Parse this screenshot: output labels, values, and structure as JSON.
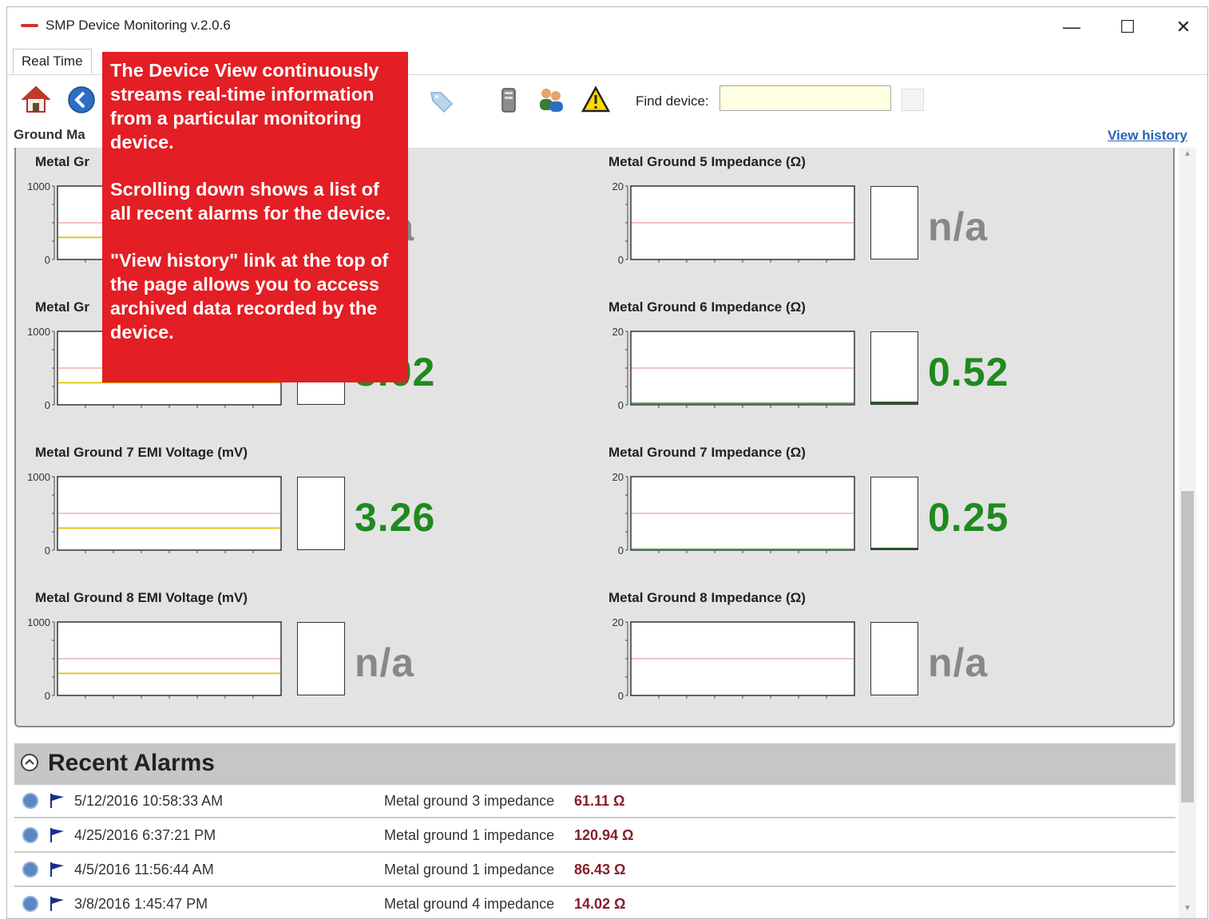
{
  "window": {
    "title": "SMP Device Monitoring v.2.0.6"
  },
  "window_controls": {
    "minimize": "—",
    "maximize": "☐",
    "close": "✕"
  },
  "tabs": [
    {
      "label": "Real Time"
    }
  ],
  "toolbar": {
    "icons": [
      "home-icon",
      "back-icon",
      "tag-icon",
      "device-icon",
      "users-icon",
      "warning-icon"
    ],
    "find_label": "Find device:",
    "find_value": ""
  },
  "breadcrumb": "Ground Ma",
  "view_history": "View history",
  "charts": [
    {
      "title": "Metal Gr",
      "ymax": "1000",
      "ymin": "0",
      "value": "n/a",
      "value_color": "#888888",
      "fill": 0,
      "line_color": "#e0c000",
      "line_level": 0.3
    },
    {
      "title": "Metal Ground 5 Impedance (Ω)",
      "ymax": "20",
      "ymin": "0",
      "value": "n/a",
      "value_color": "#888888",
      "fill": 0,
      "line_color": "",
      "line_level": 0
    },
    {
      "title": "Metal Gr",
      "ymax": "1000",
      "ymin": "0",
      "value": "3.02",
      "value_color": "#1f8a1f",
      "fill": 0,
      "line_color": "#e0c000",
      "line_level": 0.3
    },
    {
      "title": "Metal Ground 6 Impedance (Ω)",
      "ymax": "20",
      "ymin": "0",
      "value": "0.52",
      "value_color": "#1f8a1f",
      "fill": 0.03,
      "line_color": "#3a9a3a",
      "line_level": 0.02
    },
    {
      "title": "Metal Ground 7 EMI Voltage (mV)",
      "ymax": "1000",
      "ymin": "0",
      "value": "3.26",
      "value_color": "#1f8a1f",
      "fill": 0,
      "line_color": "#e0c000",
      "line_level": 0.3
    },
    {
      "title": "Metal Ground 7 Impedance (Ω)",
      "ymax": "20",
      "ymin": "0",
      "value": "0.25",
      "value_color": "#1f8a1f",
      "fill": 0.02,
      "line_color": "#3a9a3a",
      "line_level": 0.01
    },
    {
      "title": "Metal Ground 8 EMI Voltage (mV)",
      "ymax": "1000",
      "ymin": "0",
      "value": "n/a",
      "value_color": "#888888",
      "fill": 0,
      "line_color": "#e0c000",
      "line_level": 0.3
    },
    {
      "title": "Metal Ground 8 Impedance (Ω)",
      "ymax": "20",
      "ymin": "0",
      "value": "n/a",
      "value_color": "#888888",
      "fill": 0,
      "line_color": "",
      "line_level": 0
    }
  ],
  "alarms": {
    "title": "Recent Alarms",
    "rows": [
      {
        "time": "5/12/2016 10:58:33 AM",
        "desc": "Metal ground 3 impedance",
        "value": "61.11 Ω"
      },
      {
        "time": "4/25/2016 6:37:21 PM",
        "desc": "Metal ground 1 impedance",
        "value": "120.94 Ω"
      },
      {
        "time": "4/5/2016 11:56:44 AM",
        "desc": "Metal ground 1 impedance",
        "value": "86.43 Ω"
      },
      {
        "time": "3/8/2016 1:45:47 PM",
        "desc": "Metal ground 4 impedance",
        "value": "14.02 Ω"
      }
    ]
  },
  "callout": {
    "p1": "The Device View continuously streams real-time information from a particular monitoring device.",
    "p2": "Scrolling down shows a list of all recent alarms for the device.",
    "p3": "\"View history\" link at the top of the page allows you to access archived data recorded by the device."
  },
  "colors": {
    "accent_link": "#2a63b8",
    "callout_bg": "#e31e24",
    "good_value": "#1f8a1f",
    "na_value": "#888888",
    "alarm_value": "#8a1d2c"
  }
}
